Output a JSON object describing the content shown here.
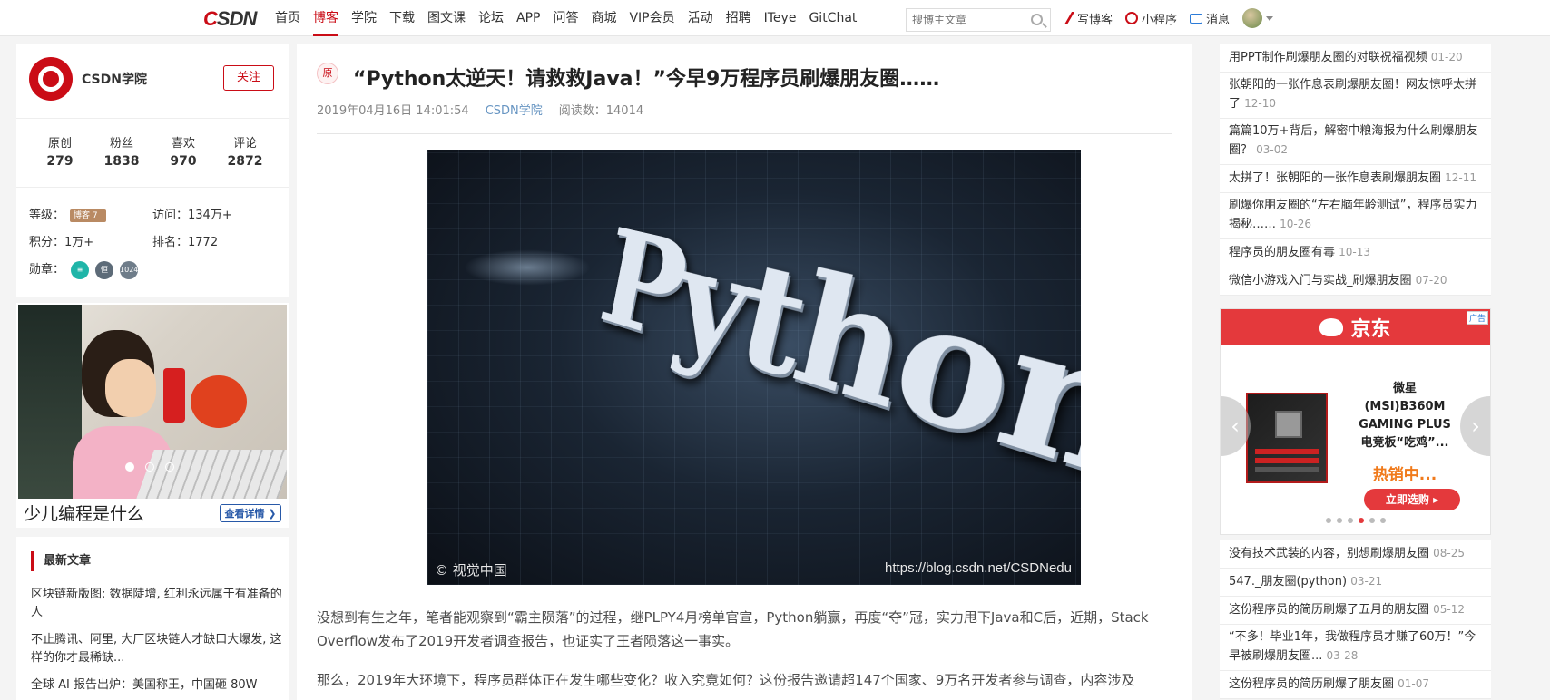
{
  "nav": {
    "logo_c": "C",
    "logo_rest": "SDN",
    "items": [
      "首页",
      "博客",
      "学院",
      "下载",
      "图文课",
      "论坛",
      "APP",
      "问答",
      "商城",
      "VIP会员",
      "活动",
      "招聘",
      "ITeye",
      "GitChat"
    ],
    "active": "博客",
    "search_placeholder": "搜博主文章",
    "write": "写博客",
    "miniprogram": "小程序",
    "messages": "消息"
  },
  "profile": {
    "name": "CSDN学院",
    "follow": "关注",
    "stats": [
      {
        "label": "原创",
        "value": "279"
      },
      {
        "label": "粉丝",
        "value": "1838"
      },
      {
        "label": "喜欢",
        "value": "970"
      },
      {
        "label": "评论",
        "value": "2872"
      }
    ],
    "level_label": "等级：",
    "level_badge": "博客 7",
    "visits_label": "访问：",
    "visits": "134万+",
    "points_label": "积分：",
    "points": "1万+",
    "rank_label": "排名：",
    "rank": "1772",
    "medals_label": "勋章：",
    "medals": [
      "≡",
      "恒",
      "1024"
    ]
  },
  "promo": {
    "text": "少儿编程是什么",
    "button": "查看详情 ❯"
  },
  "recent": {
    "title": "最新文章",
    "items": [
      "区块链新版图: 数据陡增, 红利永远属于有准备的人",
      "不止腾讯、阿里, 大厂区块链人才缺口大爆发, 这样的你才最稀缺...",
      "全球 AI 报告出炉：美国称王，中国砸 80W"
    ]
  },
  "article": {
    "original_tag": "原",
    "title": "“Python太逆天！请救救Java！”今早9万程序员刷爆朋友圈……",
    "date": "2019年04月16日 14:01:54",
    "author": "CSDN学院",
    "reads": "阅读数：14014",
    "hero_word": "Python",
    "watermark_left": "© 视觉中国",
    "watermark_right": "https://blog.csdn.net/CSDNedu",
    "para1": "没想到有生之年，笔者能观察到“霸主陨落”的过程，继PLPY4月榜单官宣，Python躺赢，再度“夺”冠，实力甩下Java和C后，近期，Stack Overflow发布了2019开发者调查报告，也证实了王者陨落这一事实。",
    "para2": "那么，2019年大环境下，程序员群体正在发生哪些变化？收入究竟如何？这份报告邀请超147个国家、9万名开发者参与调查，内容涉及"
  },
  "right_top": [
    {
      "title": "用PPT制作刷爆朋友圈的对联祝福视频",
      "date": "01-20"
    },
    {
      "title": "张朝阳的一张作息表刷爆朋友圈！网友惊呼太拼了",
      "date": "12-10"
    },
    {
      "title": "篇篇10万+背后，解密中粮海报为什么刷爆朋友圈？",
      "date": "03-02"
    },
    {
      "title": "太拼了！张朝阳的一张作息表刷爆朋友圈",
      "date": "12-11"
    },
    {
      "title": "刷爆你朋友圈的“左右脑年龄测试”，程序员实力揭秘……",
      "date": "10-26"
    },
    {
      "title": "程序员的朋友圈有毒",
      "date": "10-13"
    },
    {
      "title": "微信小游戏入门与实战_刷爆朋友圈",
      "date": "07-20"
    }
  ],
  "ad": {
    "brand": "京东",
    "tag": "广告",
    "product": "微星(MSI)B360M GAMING PLUS电竞板“吃鸡”...",
    "hot": "热销中...",
    "buy": "立即选购 ▸",
    "slides": 6,
    "active_slide": 3
  },
  "right_bottom": [
    {
      "title": "没有技术武装的内容，别想刷爆朋友圈",
      "date": "08-25"
    },
    {
      "title": "547._朋友圈(python)",
      "date": "03-21"
    },
    {
      "title": "这份程序员的简历刷爆了五月的朋友圈",
      "date": "05-12"
    },
    {
      "title": "“不多！毕业1年，我做程序员才赚了60万！”今早被刷爆朋友圈...",
      "date": "03-28"
    },
    {
      "title": "这份程序员的简历刷爆了朋友圈",
      "date": "01-07"
    }
  ],
  "colors": {
    "brand": "#ca0c16",
    "link": "#6795c2",
    "jd": "#e4393c"
  }
}
